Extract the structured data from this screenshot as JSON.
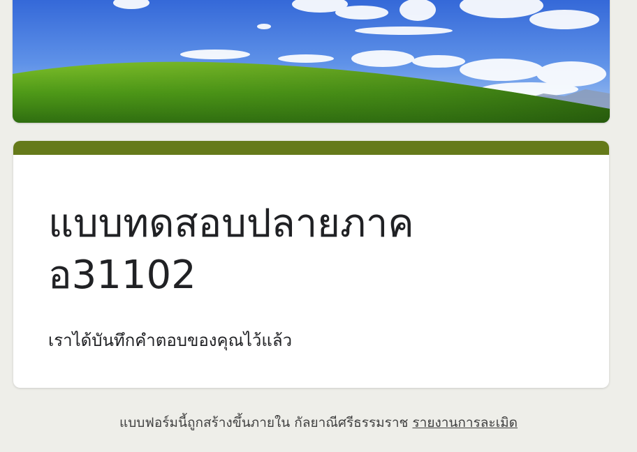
{
  "header": {
    "banner_image": "green-hill-blue-sky-landscape"
  },
  "form": {
    "accent_color": "#657a1a",
    "title": "แบบทดสอบปลายภาค\nอ31102",
    "confirmation_message": "เราได้บันทึกคำตอบของคุณไว้แล้ว"
  },
  "footer": {
    "created_in_text": "แบบฟอร์มนี้ถูกสร้างขึ้นภายใน กัลยาณีศรีธรรมราช",
    "report_link_label": "รายงานการละเมิด"
  }
}
